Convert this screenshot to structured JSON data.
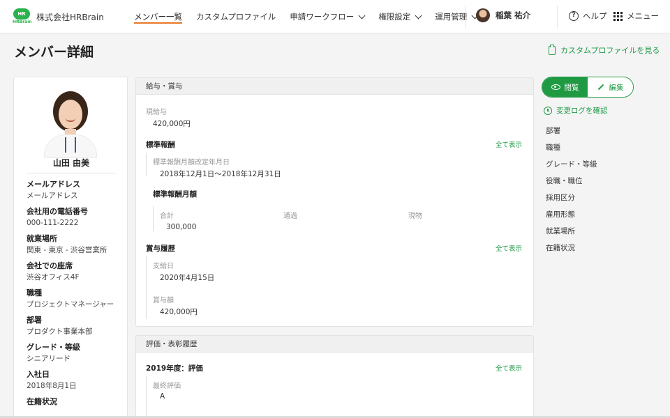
{
  "header": {
    "logo_text": "HR",
    "logo_sub": "HRBrain",
    "company": "株式会社HRBrain",
    "nav": [
      {
        "label": "メンバー一覧",
        "dropdown": false,
        "active": true
      },
      {
        "label": "カスタムプロファイル",
        "dropdown": false,
        "active": false
      },
      {
        "label": "申請ワークフロー",
        "dropdown": true,
        "active": false
      },
      {
        "label": "権限設定",
        "dropdown": true,
        "active": false
      },
      {
        "label": "運用管理",
        "dropdown": true,
        "active": false
      }
    ],
    "user_name": "稲葉 祐介",
    "help_label": "ヘルプ",
    "menu_label": "メニュー"
  },
  "page": {
    "title": "メンバー詳細",
    "custom_profile_link": "カスタムプロファイルを見る"
  },
  "profile": {
    "name": "山田 由美",
    "fields": [
      {
        "label": "メールアドレス",
        "value": "メールアドレス"
      },
      {
        "label": "会社用の電話番号",
        "value": "000-111-2222"
      },
      {
        "label": "就業場所",
        "value": "関東 - 東京 - 渋谷営業所"
      },
      {
        "label": "会社での座席",
        "value": "渋谷オフィス4F"
      },
      {
        "label": "職種",
        "value": "プロジェクトマネージャー"
      },
      {
        "label": "部署",
        "value": "プロダクト事業本部"
      },
      {
        "label": "グレード・等級",
        "value": "シニアリード"
      },
      {
        "label": "入社日",
        "value": "2018年8月1日"
      },
      {
        "label": "在籍状況",
        "value": ""
      }
    ]
  },
  "salary": {
    "header": "給与・賞与",
    "current_label": "現給与",
    "current_value": "420,000円",
    "standard_title": "標準報酬",
    "show_all": "全て表示",
    "revision_label": "標準報酬月額改定年月日",
    "revision_value": "2018年12月1日〜2018年12月31日",
    "monthly_title": "標準報酬月額",
    "cols": [
      "合計",
      "通過",
      "現物"
    ],
    "total_value": "300,000",
    "bonus_title": "賞与履歴",
    "pay_date_label": "支給日",
    "pay_date_value": "2020年4月15日",
    "bonus_amount_label": "賞与額",
    "bonus_amount_value": "420,000円"
  },
  "evaluation": {
    "header": "評価・表彰履歴",
    "year_title": "2019年度：評価",
    "show_all": "全て表示",
    "final_label": "最終評価",
    "final_value": "A"
  },
  "right_panel": {
    "view_label": "閲覧",
    "edit_label": "編集",
    "changelog": "変更ログを確認",
    "anchors": [
      "部署",
      "職種",
      "グレード・等級",
      "役職・職位",
      "採用区分",
      "雇用形態",
      "就業場所",
      "在籍状況"
    ]
  },
  "colors": {
    "brand_green": "#1f9a43",
    "nav_active_underline": "#e8792a"
  }
}
